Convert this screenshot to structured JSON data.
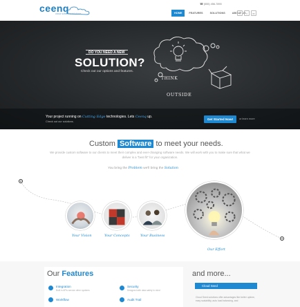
{
  "header": {
    "logo": "ceenq",
    "logo_tagline": "cloud software solutions",
    "phone": "☎ (555) 456-7890",
    "nav": [
      "Home",
      "Features",
      "Solutions",
      "About Us"
    ],
    "social": [
      "f",
      "t",
      "in"
    ]
  },
  "hero": {
    "question": "DO YOU NEED A NEW",
    "title": "SOLUTION?",
    "subtitle": "Check out our options and features.",
    "chalk_think": "THINK",
    "chalk_outside": "OUTSIDE",
    "ribbon_pre": "Your project running on ",
    "ribbon_hl": "Cutting Edge",
    "ribbon_mid": " technologies. Lets ",
    "ribbon_brand": "Ceenq",
    "ribbon_post": " up.",
    "ribbon_sub": "Check out our solutions.",
    "cta": "Get Started Now!",
    "learn_more": "or learn more"
  },
  "custom": {
    "title_pre": "Custom ",
    "title_hl": "Software",
    "title_post": " to meet your needs.",
    "description": "We provide custom software to our clients to meet their complex and ever-changing software needs. We will work with you to make sure that what we deliver is a \"best fit\" for your organization.",
    "bring_pre": "You bring the ",
    "bring_problem": "Problem",
    "bring_mid": " we'll bring the ",
    "bring_solution": "Solution",
    "steps": [
      "Your Vision",
      "Your Concepts",
      "Your Business",
      "Our Effort"
    ]
  },
  "features": {
    "title_pre": "Our ",
    "title_bold": "Features",
    "items": [
      {
        "name": "Integration",
        "desc": "Built in APIs service other systems"
      },
      {
        "name": "Security",
        "desc": "Designed with data safety in mind"
      },
      {
        "name": "Workflow",
        "desc": ""
      },
      {
        "name": "Audit Trail",
        "desc": ""
      }
    ],
    "more_title": "and more...",
    "cloud_seed": "Cloud Seed",
    "cloud_desc": "Cloud Seed solutions offer advantages like better uptime, easy scalability, auto load balancing, and"
  },
  "colors": {
    "accent": "#1e88d0",
    "hero_bg": "#25282a"
  }
}
